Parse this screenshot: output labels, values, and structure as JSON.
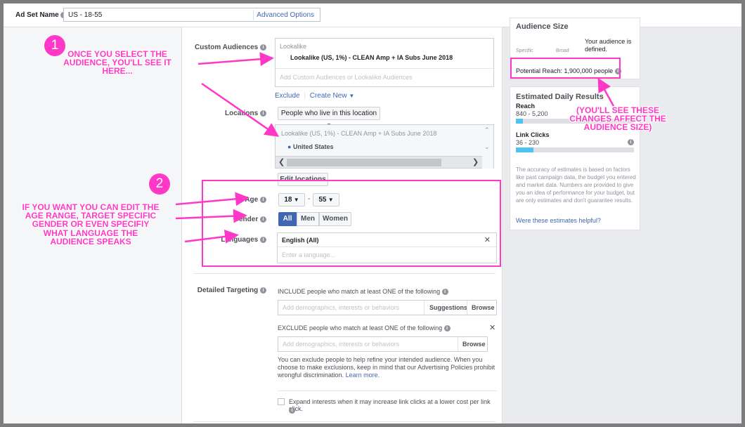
{
  "adset": {
    "name_label": "Ad Set Name",
    "name_value": "US - 18-55",
    "advanced_options": "Advanced Options"
  },
  "custom_audiences": {
    "label": "Custom Audiences",
    "group_header": "Lookalike",
    "selected": "Lookalike (US, 1%) - CLEAN Amp + IA Subs June 2018",
    "placeholder": "Add Custom Audiences or Lookalike Audiences",
    "exclude": "Exclude",
    "create_new": "Create New"
  },
  "locations": {
    "label": "Locations",
    "dropdown": "People who live in this location",
    "list_header": "Lookalike (US, 1%) - CLEAN Amp + IA Subs June 2018",
    "country": "United States",
    "edit": "Edit locations"
  },
  "age": {
    "label": "Age",
    "min": "18",
    "separator": "-",
    "max": "55"
  },
  "gender": {
    "label": "Gender",
    "options": [
      "All",
      "Men",
      "Women"
    ],
    "selected": "All"
  },
  "languages": {
    "label": "Languages",
    "selected": "English (All)",
    "placeholder": "Enter a language..."
  },
  "detailed_targeting": {
    "label": "Detailed Targeting",
    "include_header": "INCLUDE people who match at least ONE of the following",
    "include_placeholder": "Add demographics, interests or behaviors",
    "suggestions": "Suggestions",
    "browse": "Browse",
    "exclude_header": "EXCLUDE people who match at least ONE of the following",
    "exclude_placeholder": "Add demographics, interests or behaviors",
    "exclude_browse": "Browse",
    "help_text": "You can exclude people to help refine your intended audience. When you choose to make exclusions, keep in mind that our Advertising Policies prohibit wrongful discrimination.",
    "learn_more": "Learn more.",
    "expand_checkbox": "Expand interests when it may increase link clicks at a lower cost per link click."
  },
  "audience_size": {
    "title": "Audience Size",
    "specific": "Specific",
    "broad": "Broad",
    "status": "Your audience is defined.",
    "potential_reach": "Potential Reach: 1,900,000 people"
  },
  "estimated": {
    "title": "Estimated Daily Results",
    "reach_label": "Reach",
    "reach_range": "840 - 5,200",
    "reach_level": 0.06,
    "clicks_label": "Link Clicks",
    "clicks_range": "36 - 230",
    "clicks_level": 0.15,
    "disclaimer": "The accuracy of estimates is based on factors like past campaign data, the budget you entered and market data. Numbers are provided to give you an idea of performance for your budget, but are only estimates and don't guarantee results.",
    "helpful_link": "Were these estimates helpful?"
  },
  "annotations": {
    "step1": "1",
    "step1_text": "ONCE YOU SELECT THE AUDIENCE, YOU'LL SEE IT HERE...",
    "step2": "2",
    "step2_text": "IF YOU WANT YOU CAN EDIT THE AGE RANGE, TARGET SPECIFIC GENDER OR EVEN SPECIFIY WHAT LANGUAGE THE AUDIENCE SPEAKS",
    "reach_text": "(YOU'LL SEE THESE CHANGES AFFECT THE AUDIENCE SIZE)",
    "color": "#ff38c8"
  }
}
